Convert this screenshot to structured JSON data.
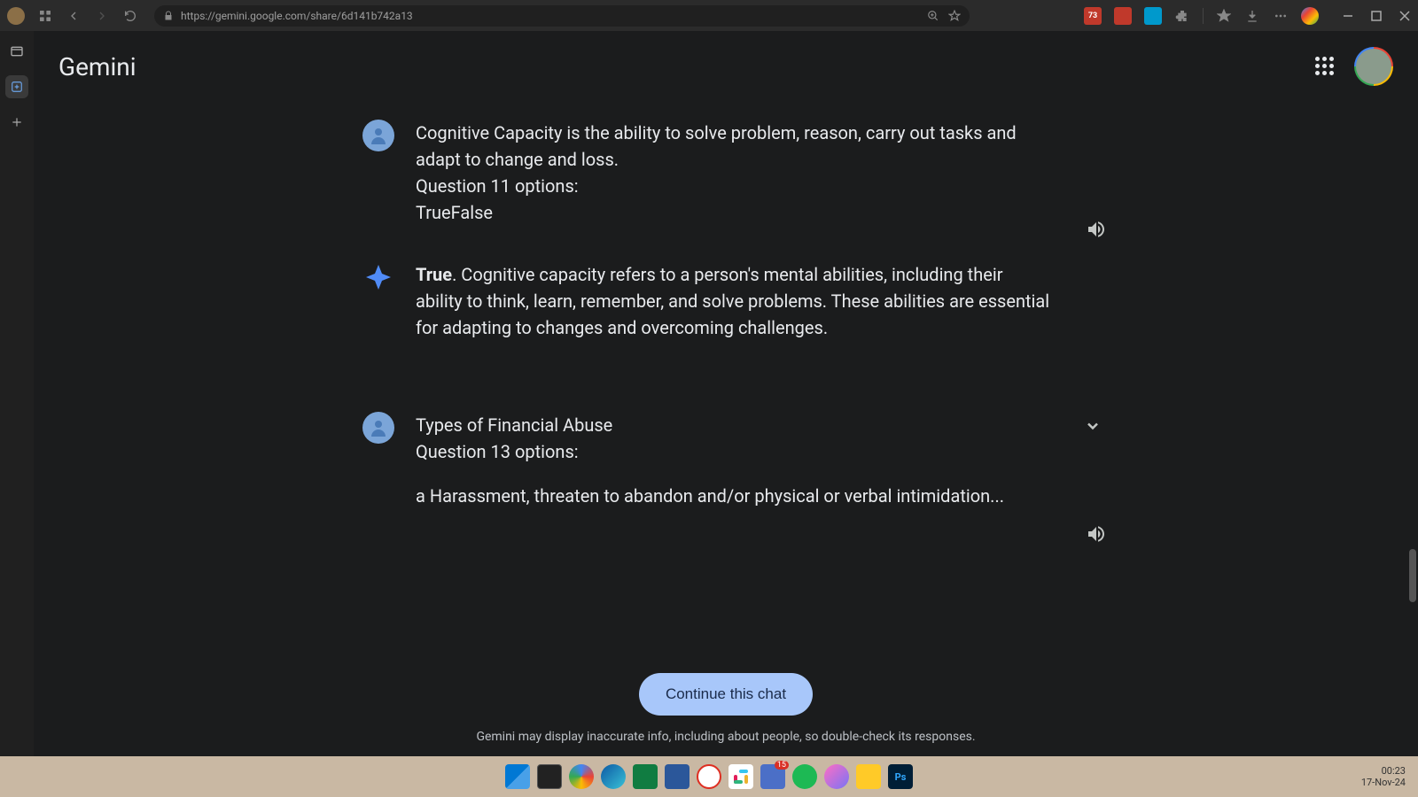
{
  "browser": {
    "url": "https://gemini.google.com/share/6d141b742a13",
    "ext_badge": "73"
  },
  "app": {
    "title": "Gemini"
  },
  "messages": {
    "m1_line1": "Cognitive Capacity is the ability to solve problem, reason, carry out tasks and adapt to change and loss.",
    "m1_line2": "Question 11 options:",
    "m1_line3": "TrueFalse",
    "m2_bold": "True",
    "m2_rest": ". Cognitive capacity refers to a person's mental abilities, including their ability to think, learn, remember, and solve problems. These abilities are essential for adapting to changes and overcoming challenges.",
    "m3_line1": "Types of Financial Abuse",
    "m3_line2": "Question 13 options:",
    "m3_line3": "a Harassment, threaten to abandon and/or physical or verbal intimidation..."
  },
  "actions": {
    "continue": "Continue this chat"
  },
  "footer": {
    "disclaimer": "Gemini may display inaccurate info, including about people, so double-check its responses."
  },
  "taskbar": {
    "teams_badge": "15",
    "time": "00:23",
    "date": "17-Nov-24"
  }
}
